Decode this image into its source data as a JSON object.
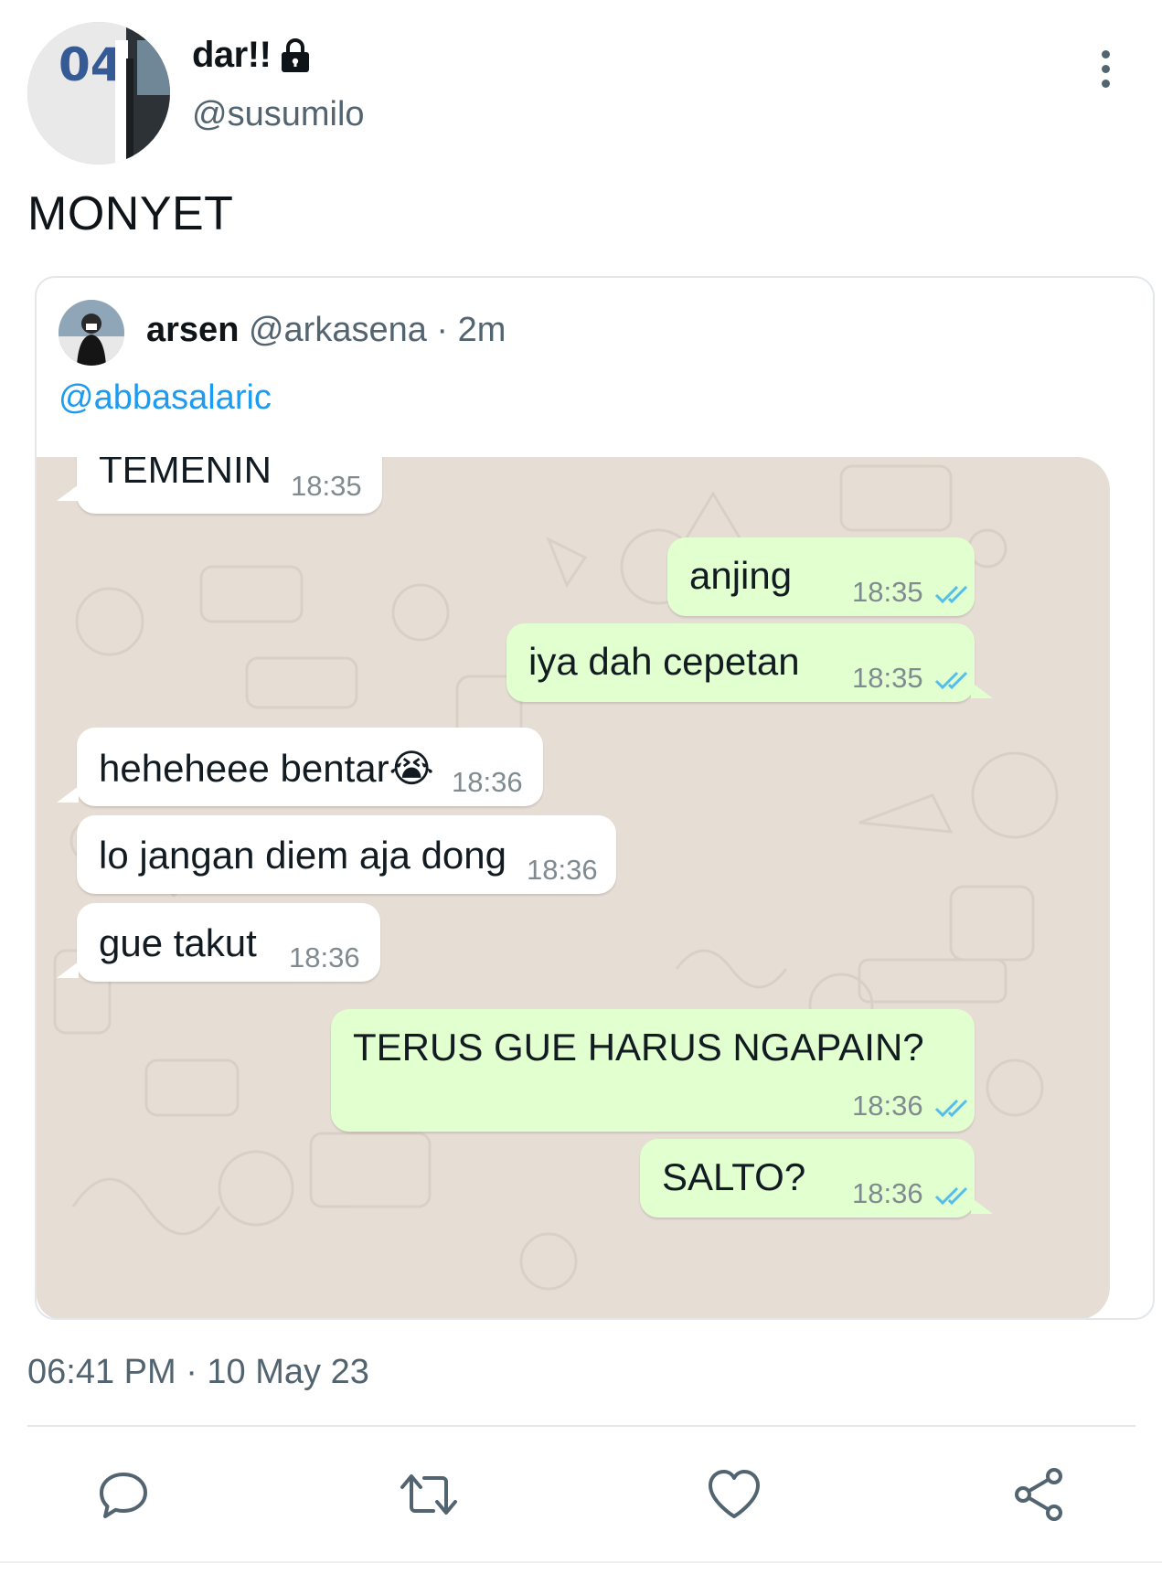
{
  "tweet": {
    "display_name": "dar!!",
    "handle": "@susumilo",
    "text": "MONYET",
    "timestamp": "06:41 PM · 10 May 23"
  },
  "quote": {
    "name": "arsen",
    "handle": "@arkasena",
    "separator": " · ",
    "time": "2m",
    "mention": "@abbasalaric"
  },
  "chat": {
    "messages": [
      {
        "dir": "in",
        "text": "TEMENIN",
        "time": "18:35"
      },
      {
        "dir": "out",
        "text": "anjing",
        "time": "18:35"
      },
      {
        "dir": "out",
        "text": "iya dah cepetan",
        "time": "18:35"
      },
      {
        "dir": "in",
        "text": "heheheee bentar😭",
        "time": "18:36"
      },
      {
        "dir": "in",
        "text": "lo jangan diem aja dong",
        "time": "18:36"
      },
      {
        "dir": "in",
        "text": "gue takut",
        "time": "18:36"
      },
      {
        "dir": "out",
        "text": "TERUS GUE HARUS NGAPAIN?",
        "time": "18:36"
      },
      {
        "dir": "out",
        "text": "SALTO?",
        "time": "18:36"
      }
    ]
  },
  "icons": {
    "lock": "lock-icon",
    "more": "more-vertical-icon",
    "reply": "reply-icon",
    "retweet": "retweet-icon",
    "like": "heart-icon",
    "share": "share-icon",
    "read_receipt": "double-check-icon"
  },
  "colors": {
    "link": "#1d9bf0",
    "secondary_text": "#536471",
    "outgoing_bubble": "#e2ffd0",
    "chat_background": "#e6ded5",
    "read_ticks": "#53bdeb"
  }
}
